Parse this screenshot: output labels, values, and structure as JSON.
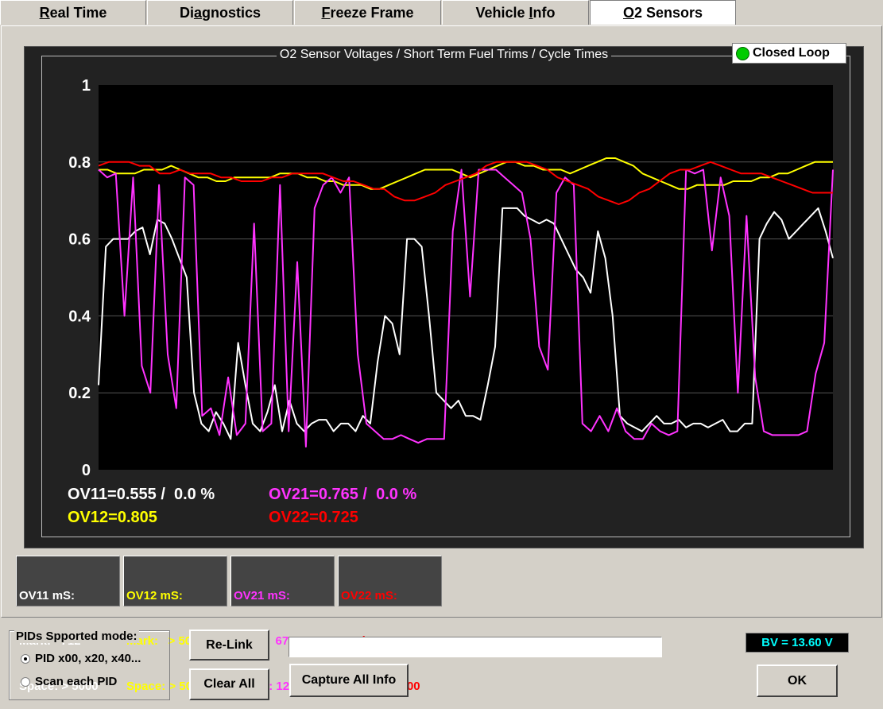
{
  "tabs": [
    {
      "prefix": "",
      "underline": "R",
      "rest": "eal Time"
    },
    {
      "prefix": "Di",
      "underline": "a",
      "rest": "gnostics"
    },
    {
      "prefix": "",
      "underline": "F",
      "rest": "reeze Frame"
    },
    {
      "prefix": "Vehicle ",
      "underline": "I",
      "rest": "nfo"
    },
    {
      "prefix": "",
      "underline": "O",
      "rest": "2 Sensors"
    }
  ],
  "chart_title": "O2 Sensor Voltages / Short Term Fuel Trims / Cycle Times",
  "status": {
    "label": "Closed Loop",
    "color": "#00cc00"
  },
  "readouts": {
    "ov11": "OV11=0.555 /  0.0 %",
    "ov12": "OV12=0.805",
    "ov21": "OV21=0.765 /  0.0 %",
    "ov22": "OV22=0.725"
  },
  "ms_boxes": [
    {
      "title": "OV11 mS:",
      "mark": "Mark:   712",
      "space": "Space: > 5000",
      "color": "#ffffff"
    },
    {
      "title": "OV12 mS:",
      "mark": "Mark:   > 5000",
      "space": "Space: > 5000",
      "color": "#ffff00"
    },
    {
      "title": "OV21 mS:",
      "mark": "Mark:   673",
      "space": "Space: 1259",
      "color": "#ff33ff"
    },
    {
      "title": "OV22 mS:",
      "mark": "Mark:    > 5000",
      "space": "Space: > 5000",
      "color": "#ff0000"
    }
  ],
  "pid_mode": {
    "label": "PIDs Spported mode:",
    "options": [
      "PID x00, x20, x40...",
      "Scan each PID"
    ],
    "selected": 0
  },
  "buttons": {
    "relink": "Re-Link",
    "clear_all": "Clear All",
    "capture": "Capture All Info",
    "ok": "OK"
  },
  "battery_voltage": "BV = 13.60 V",
  "colors": {
    "ov11": "#ffffff",
    "ov12": "#ffff00",
    "ov21": "#ff33ff",
    "ov22": "#ff0000"
  },
  "chart_data": {
    "type": "line",
    "ylim": [
      0,
      1
    ],
    "yticks": [
      "0",
      "0.2",
      "0.4",
      "0.6",
      "0.8",
      "1"
    ],
    "grid": true,
    "x": [
      0,
      6,
      12,
      18,
      24,
      30,
      36,
      42,
      48,
      54,
      60,
      66,
      72,
      78,
      84,
      90,
      96,
      102,
      108,
      114,
      120,
      126,
      132,
      138,
      144,
      150,
      156,
      162,
      168,
      174,
      180,
      186,
      192,
      198,
      204,
      210,
      216,
      222,
      228,
      234,
      240,
      246,
      252,
      258,
      264,
      270,
      276,
      282,
      288,
      294,
      300,
      306,
      312,
      318,
      324,
      330,
      336,
      342,
      348,
      354,
      360,
      366,
      372,
      378,
      384,
      390,
      396,
      402,
      408,
      414,
      420,
      426,
      432,
      438,
      444,
      450,
      456,
      462,
      468,
      474,
      480,
      486,
      492,
      498,
      504,
      510,
      516,
      522,
      528,
      534,
      540,
      546,
      552,
      558,
      564,
      570,
      576,
      582,
      588,
      594,
      600
    ],
    "series": [
      {
        "name": "OV11",
        "color": "#ffffff",
        "values": [
          0.22,
          0.58,
          0.6,
          0.6,
          0.6,
          0.62,
          0.63,
          0.56,
          0.65,
          0.64,
          0.6,
          0.55,
          0.5,
          0.2,
          0.12,
          0.1,
          0.15,
          0.12,
          0.08,
          0.33,
          0.22,
          0.12,
          0.1,
          0.15,
          0.22,
          0.1,
          0.18,
          0.12,
          0.1,
          0.12,
          0.13,
          0.13,
          0.1,
          0.12,
          0.12,
          0.1,
          0.14,
          0.12,
          0.28,
          0.4,
          0.38,
          0.3,
          0.6,
          0.6,
          0.58,
          0.4,
          0.2,
          0.18,
          0.16,
          0.18,
          0.14,
          0.14,
          0.13,
          0.22,
          0.32,
          0.68,
          0.68,
          0.68,
          0.66,
          0.65,
          0.64,
          0.65,
          0.64,
          0.6,
          0.56,
          0.52,
          0.5,
          0.46,
          0.62,
          0.55,
          0.4,
          0.14,
          0.12,
          0.11,
          0.1,
          0.12,
          0.14,
          0.12,
          0.12,
          0.13,
          0.11,
          0.12,
          0.12,
          0.11,
          0.12,
          0.13,
          0.1,
          0.1,
          0.12,
          0.12,
          0.6,
          0.64,
          0.67,
          0.65,
          0.6,
          0.62,
          0.64,
          0.66,
          0.68,
          0.62,
          0.55
        ]
      },
      {
        "name": "OV12",
        "color": "#ffff00",
        "values": [
          0.78,
          0.78,
          0.77,
          0.77,
          0.77,
          0.78,
          0.78,
          0.78,
          0.79,
          0.78,
          0.77,
          0.76,
          0.76,
          0.75,
          0.75,
          0.76,
          0.76,
          0.76,
          0.76,
          0.76,
          0.77,
          0.77,
          0.77,
          0.76,
          0.76,
          0.75,
          0.75,
          0.74,
          0.74,
          0.74,
          0.73,
          0.73,
          0.74,
          0.75,
          0.76,
          0.77,
          0.78,
          0.78,
          0.78,
          0.78,
          0.77,
          0.76,
          0.77,
          0.78,
          0.79,
          0.8,
          0.8,
          0.79,
          0.79,
          0.78,
          0.78,
          0.78,
          0.77,
          0.78,
          0.79,
          0.8,
          0.81,
          0.81,
          0.8,
          0.79,
          0.77,
          0.76,
          0.75,
          0.74,
          0.73,
          0.73,
          0.74,
          0.74,
          0.74,
          0.74,
          0.75,
          0.75,
          0.75,
          0.76,
          0.76,
          0.77,
          0.77,
          0.78,
          0.79,
          0.8,
          0.8,
          0.8
        ]
      },
      {
        "name": "OV21",
        "color": "#ff33ff",
        "values": [
          0.78,
          0.76,
          0.77,
          0.4,
          0.76,
          0.27,
          0.2,
          0.74,
          0.3,
          0.16,
          0.76,
          0.74,
          0.14,
          0.16,
          0.09,
          0.24,
          0.09,
          0.12,
          0.64,
          0.1,
          0.12,
          0.74,
          0.1,
          0.54,
          0.06,
          0.68,
          0.74,
          0.76,
          0.72,
          0.76,
          0.3,
          0.12,
          0.1,
          0.08,
          0.08,
          0.09,
          0.08,
          0.07,
          0.08,
          0.08,
          0.08,
          0.62,
          0.78,
          0.45,
          0.78,
          0.78,
          0.78,
          0.76,
          0.74,
          0.72,
          0.6,
          0.32,
          0.26,
          0.72,
          0.76,
          0.74,
          0.12,
          0.1,
          0.14,
          0.1,
          0.16,
          0.1,
          0.08,
          0.08,
          0.12,
          0.1,
          0.09,
          0.1,
          0.78,
          0.77,
          0.78,
          0.57,
          0.76,
          0.66,
          0.2,
          0.66,
          0.24,
          0.1,
          0.09,
          0.09,
          0.09,
          0.09,
          0.1,
          0.25,
          0.33,
          0.78
        ]
      },
      {
        "name": "OV22",
        "color": "#ff0000",
        "values": [
          0.79,
          0.8,
          0.8,
          0.8,
          0.79,
          0.79,
          0.77,
          0.77,
          0.78,
          0.77,
          0.77,
          0.77,
          0.76,
          0.76,
          0.75,
          0.75,
          0.75,
          0.76,
          0.76,
          0.77,
          0.77,
          0.77,
          0.77,
          0.76,
          0.75,
          0.75,
          0.74,
          0.73,
          0.73,
          0.71,
          0.7,
          0.7,
          0.71,
          0.72,
          0.74,
          0.75,
          0.76,
          0.77,
          0.79,
          0.8,
          0.8,
          0.8,
          0.8,
          0.79,
          0.78,
          0.76,
          0.75,
          0.74,
          0.73,
          0.71,
          0.7,
          0.69,
          0.7,
          0.72,
          0.73,
          0.75,
          0.77,
          0.78,
          0.78,
          0.79,
          0.8,
          0.79,
          0.78,
          0.77,
          0.77,
          0.77,
          0.76,
          0.75,
          0.74,
          0.73,
          0.72,
          0.72,
          0.72
        ]
      }
    ]
  }
}
